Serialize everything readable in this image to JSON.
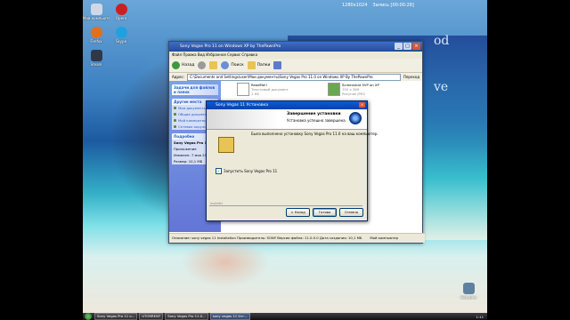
{
  "topbar": {
    "resolution": "1280x1024",
    "record": "Запись [00:00:28]"
  },
  "desktop_icons": [
    {
      "label": "Мой компьютер",
      "color": "#d0d8e8"
    },
    {
      "label": "Opera",
      "color": "#cc2020"
    },
    {
      "label": "Firefox",
      "color": "#e07020"
    },
    {
      "label": "Skype",
      "color": "#20a0e0"
    },
    {
      "label": "Steam",
      "color": "#303848"
    },
    {
      "label": "Корзина",
      "color": "#6080a0"
    }
  ],
  "wallpaper": {
    "text1": "od",
    "text2": "ve"
  },
  "explorer": {
    "title": "Sony Vegas Pro 11 on Windows XP by ThePawnPro",
    "menu": "Файл  Правка  Вид  Избранное  Сервис  Справка",
    "toolbar": {
      "back": "Назад",
      "search": "Поиск",
      "folders": "Папки"
    },
    "address_label": "Адрес:",
    "address": "C:\\Documents and Settings\\user\\Мои документы\\Sony Vegas Pro 11.0 on Windows XP By ThePawnPro",
    "go": "Переход",
    "taskpane": {
      "tasks_title": "Задачи для файлов и папок",
      "other_title": "Другие места",
      "other_items": [
        "Мои документы",
        "Общие документы",
        "Мой компьютер",
        "Сетевое окружение"
      ],
      "details_title": "Подробно",
      "details": [
        "Sony Vegas Pro 11.0 on Windows XP By ThePawnPro",
        "Приложение",
        "Изменен: 7 мая 2012",
        "Размер: 10,1 МБ"
      ]
    },
    "files": [
      {
        "name": "ReadMe!!",
        "meta1": "Текстовый документ",
        "meta2": "1 КБ",
        "thumb": "#ffffff"
      },
      {
        "name": "Screenshot SVP on XP",
        "meta1": "792 x 369",
        "meta2": "Рисунок JPEG",
        "thumb": "#6aa84f"
      }
    ],
    "status": "Описание: sony vegas 11 Installation Производитель: SONY Версия файла: 11.0.0.0 Дата создания: 10,1 МБ",
    "status_right": "Мой компьютер"
  },
  "installer": {
    "title": "Sony Vegas 11 Установка",
    "header_line1": "Завершение установки",
    "header_line2": "Установка успешно завершена",
    "message": "Было выполнено установку Sony Vegas Pro 11.0 на ваш компьютер.",
    "checkbox_label": "Запустить Sony Vegas Pro 11",
    "checkbox_checked": true,
    "footer_brand": "Installer",
    "buttons": {
      "back": "< Назад",
      "finish": "Готово",
      "cancel": "Отмена"
    }
  },
  "taskbar": {
    "tasks": [
      "Sony Vegas Pro 11 o...",
      "UTORRENT",
      "Sony Vegas Pro 11.0...",
      "sony vegas 11 Уст..."
    ],
    "clock": "1:11"
  }
}
